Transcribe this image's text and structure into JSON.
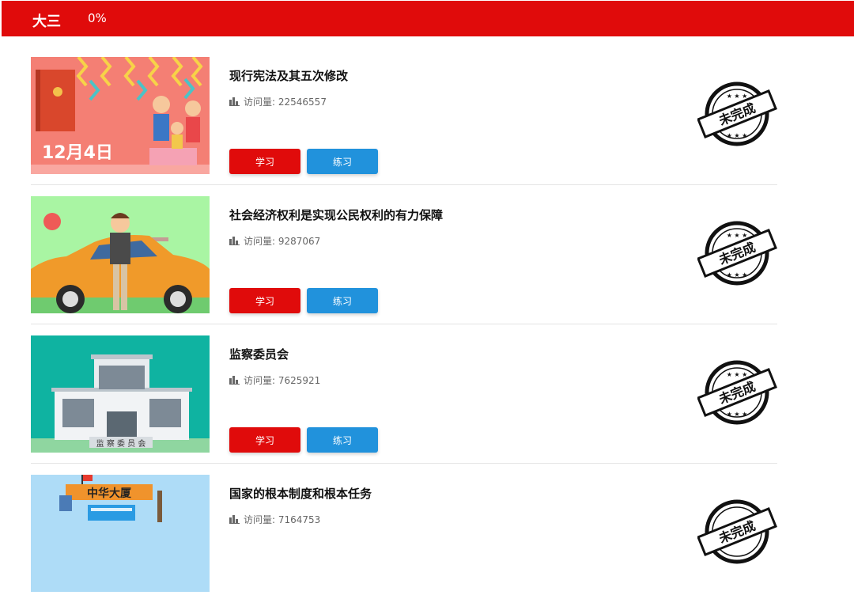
{
  "header": {
    "grade": "大三",
    "progress": "0%"
  },
  "labels": {
    "visits_prefix": "访问量:",
    "study": "学习",
    "practice": "练习",
    "stamp": "未完成"
  },
  "courses": [
    {
      "title": "现行宪法及其五次修改",
      "visits": "22546557",
      "thumb_text": "12月4日"
    },
    {
      "title": "社会经济权利是实现公民权利的有力保障",
      "visits": "9287067"
    },
    {
      "title": "监察委员会",
      "visits": "7625921",
      "thumb_text": "监 察 委 员 会"
    },
    {
      "title": "国家的根本制度和根本任务",
      "visits": "7164753",
      "thumb_text": "中华大厦"
    }
  ],
  "colors": {
    "brand_red": "#e00b0b",
    "practice_blue": "#2192dc",
    "stamp_black": "#111111"
  }
}
